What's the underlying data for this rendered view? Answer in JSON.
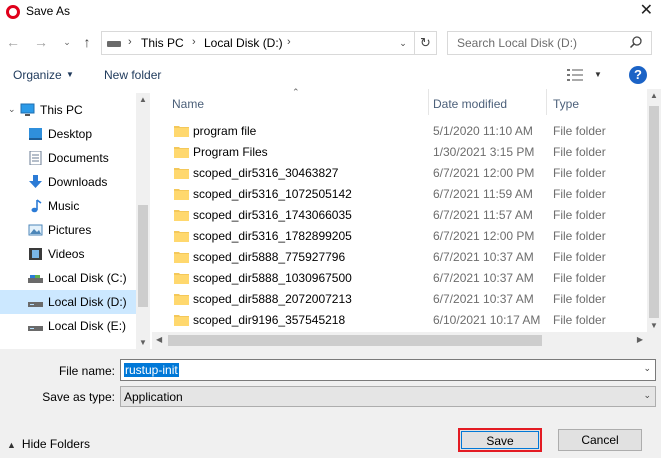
{
  "window": {
    "title": "Save As",
    "close_glyph": "✕",
    "accent": "#e0001b"
  },
  "nav": {
    "back_glyph": "←",
    "forward_glyph": "→",
    "history_glyph": "⌄",
    "up_glyph": "↑",
    "breadcrumb": [
      "This PC",
      "Local Disk (D:)"
    ],
    "sep_glyph": "›",
    "dropdown_glyph": "⌄",
    "refresh_glyph": "↻",
    "search_placeholder": "Search Local Disk (D:)"
  },
  "toolbar": {
    "organize_label": "Organize",
    "organize_caret": "▼",
    "new_folder_label": "New folder",
    "view_caret": "▼",
    "help_label": "?"
  },
  "sidebar": {
    "items": [
      {
        "label": "This PC",
        "icon": "computer-icon",
        "expand": "⌄"
      },
      {
        "label": "Desktop",
        "icon": "desktop-icon"
      },
      {
        "label": "Documents",
        "icon": "documents-icon"
      },
      {
        "label": "Downloads",
        "icon": "downloads-icon"
      },
      {
        "label": "Music",
        "icon": "music-icon"
      },
      {
        "label": "Pictures",
        "icon": "pictures-icon"
      },
      {
        "label": "Videos",
        "icon": "videos-icon"
      },
      {
        "label": "Local Disk (C:)",
        "icon": "drive-icon"
      },
      {
        "label": "Local Disk (D:)",
        "icon": "drive-icon",
        "selected": true
      },
      {
        "label": "Local Disk (E:)",
        "icon": "drive-icon"
      }
    ],
    "scroll_up": "▲",
    "scroll_down": "▼"
  },
  "files": {
    "columns": {
      "name": "Name",
      "date": "Date modified",
      "type": "Type"
    },
    "sort_caret": "⌃",
    "rows": [
      {
        "name": "program file",
        "date": "5/1/2020 11:10 AM",
        "type": "File folder"
      },
      {
        "name": "Program Files",
        "date": "1/30/2021 3:15 PM",
        "type": "File folder"
      },
      {
        "name": "scoped_dir5316_30463827",
        "date": "6/7/2021 12:00 PM",
        "type": "File folder"
      },
      {
        "name": "scoped_dir5316_1072505142",
        "date": "6/7/2021 11:59 AM",
        "type": "File folder"
      },
      {
        "name": "scoped_dir5316_1743066035",
        "date": "6/7/2021 11:57 AM",
        "type": "File folder"
      },
      {
        "name": "scoped_dir5316_1782899205",
        "date": "6/7/2021 12:00 PM",
        "type": "File folder"
      },
      {
        "name": "scoped_dir5888_775927796",
        "date": "6/7/2021 10:37 AM",
        "type": "File folder"
      },
      {
        "name": "scoped_dir5888_1030967500",
        "date": "6/7/2021 10:37 AM",
        "type": "File folder"
      },
      {
        "name": "scoped_dir5888_2072007213",
        "date": "6/7/2021 10:37 AM",
        "type": "File folder"
      },
      {
        "name": "scoped_dir9196_357545218",
        "date": "6/10/2021 10:17 AM",
        "type": "File folder"
      }
    ],
    "scroll_up": "▲",
    "scroll_down": "▼",
    "scroll_left": "◀",
    "scroll_right": "▶"
  },
  "form": {
    "file_name_label": "File name:",
    "file_name_value": "rustup-init",
    "save_type_label": "Save as type:",
    "save_type_value": "Application",
    "dropdown_glyph": "⌄",
    "hide_folders_label": "Hide Folders",
    "hide_folders_caret": "▲",
    "save_label": "Save",
    "cancel_label": "Cancel",
    "highlight_color": "#e31b23"
  }
}
